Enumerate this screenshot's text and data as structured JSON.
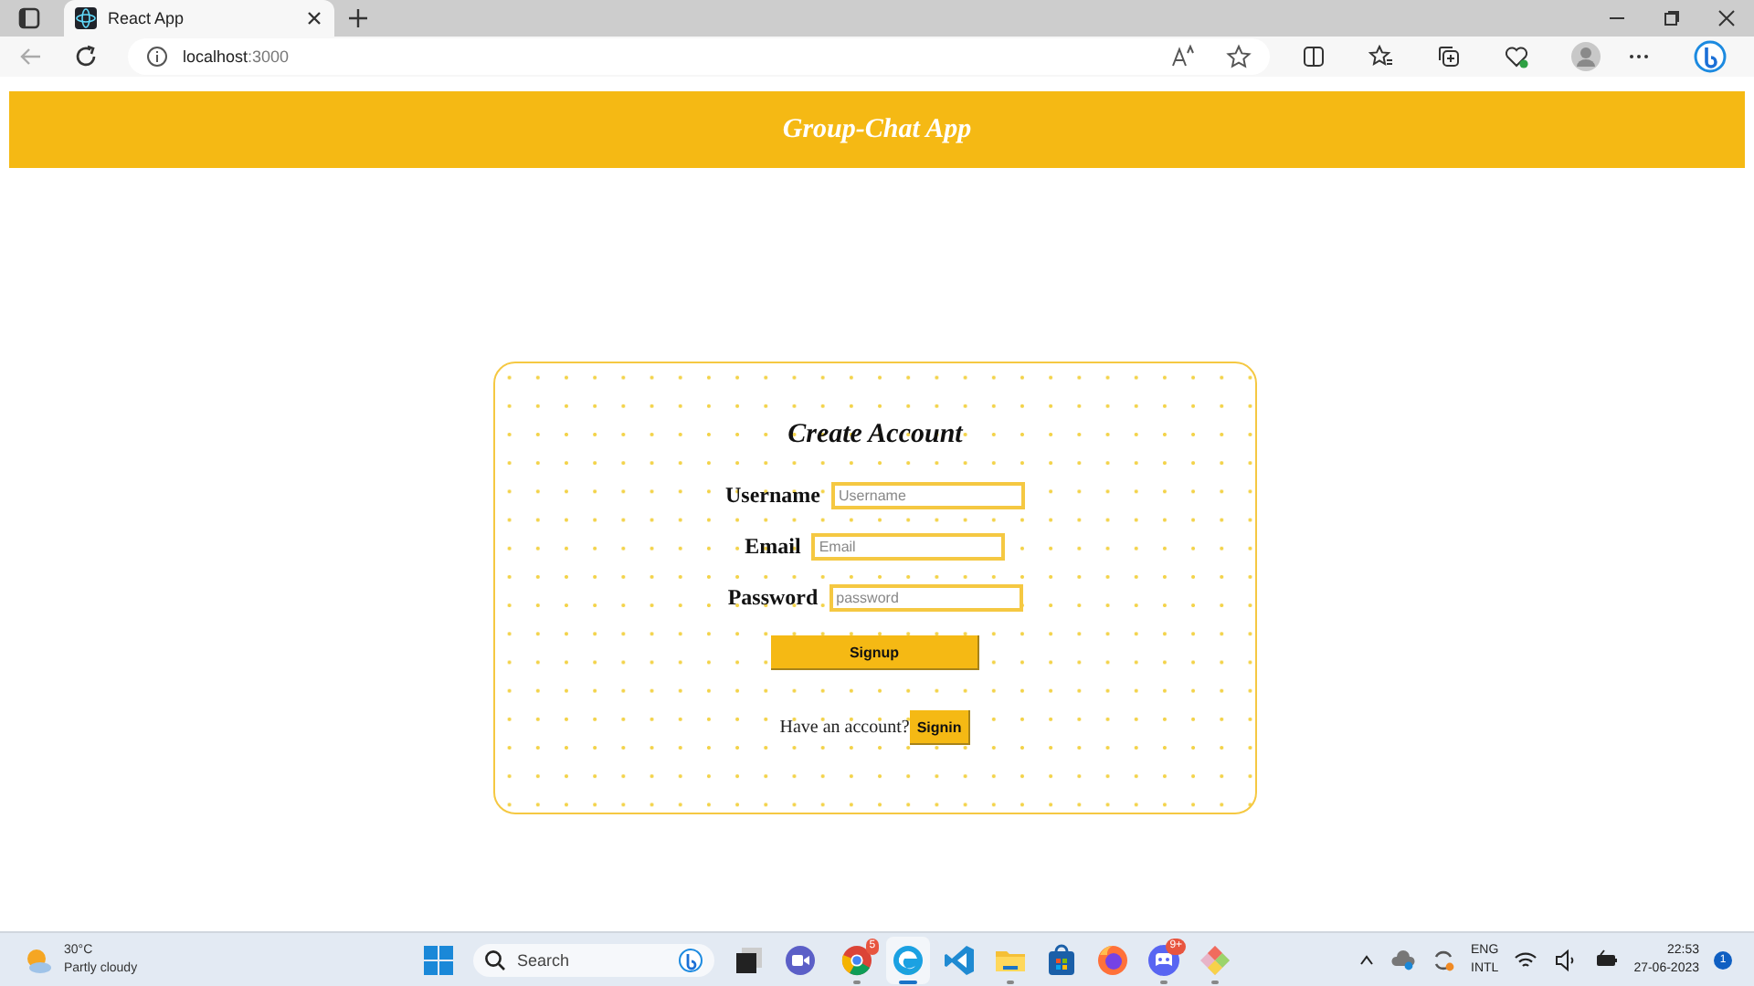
{
  "browser": {
    "tab_title": "React App",
    "url_host": "localhost",
    "url_port": ":3000"
  },
  "header": {
    "title": "Group-Chat App"
  },
  "form": {
    "title": "Create Account",
    "fields": [
      {
        "label": "Username",
        "placeholder": "Username"
      },
      {
        "label": "Email",
        "placeholder": "Email"
      },
      {
        "label": "Password",
        "placeholder": "password"
      }
    ],
    "submit": "Signup",
    "footer_text": "Have an account?",
    "signin": "Signin"
  },
  "taskbar": {
    "temperature": "30°C",
    "weather": "Partly cloudy",
    "search_placeholder": "Search",
    "apps": [
      {
        "kind": "chrome",
        "badge": "5",
        "running": true,
        "active": false
      },
      {
        "kind": "edge",
        "running": true,
        "active": true
      },
      {
        "kind": "vscode",
        "running": false,
        "active": false
      },
      {
        "kind": "files",
        "running": true,
        "active": false
      },
      {
        "kind": "store",
        "running": false,
        "active": false
      },
      {
        "kind": "firefox",
        "running": false,
        "active": false
      },
      {
        "kind": "discord",
        "badge": "9+",
        "running": true,
        "active": false
      },
      {
        "kind": "git",
        "running": true,
        "active": false
      }
    ],
    "language": "ENG",
    "layout": "INTL",
    "time": "22:53",
    "date": "27-06-2023",
    "notifications": "1"
  }
}
